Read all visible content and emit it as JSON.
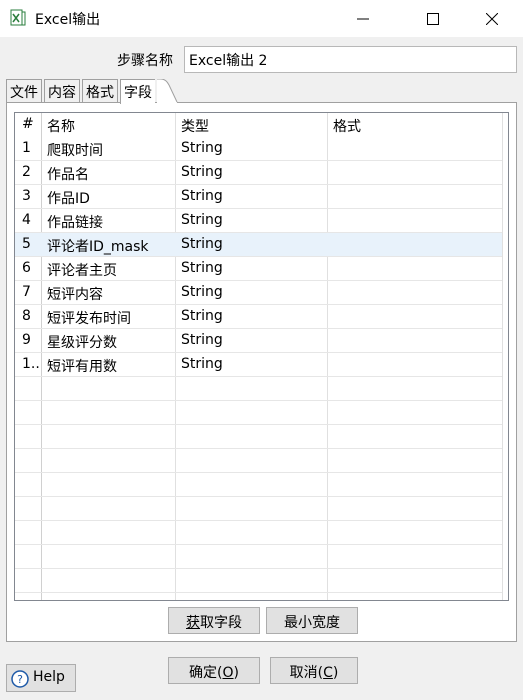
{
  "window": {
    "title": "Excel输出"
  },
  "step_name": {
    "label": "步骤名称",
    "value": "Excel输出 2"
  },
  "tabs": [
    {
      "label": "文件"
    },
    {
      "label": "内容"
    },
    {
      "label": "格式"
    },
    {
      "label": "字段"
    }
  ],
  "active_tab": "字段",
  "grid": {
    "columns": [
      "#",
      "名称",
      "类型",
      "格式"
    ],
    "rows": [
      {
        "num": "1",
        "name": "爬取时间",
        "type": "String",
        "format": ""
      },
      {
        "num": "2",
        "name": "作品名",
        "type": "String",
        "format": ""
      },
      {
        "num": "3",
        "name": "作品ID",
        "type": "String",
        "format": ""
      },
      {
        "num": "4",
        "name": "作品链接",
        "type": "String",
        "format": ""
      },
      {
        "num": "5",
        "name": "评论者ID_mask",
        "type": "String",
        "format": ""
      },
      {
        "num": "6",
        "name": "评论者主页",
        "type": "String",
        "format": ""
      },
      {
        "num": "7",
        "name": "短评内容",
        "type": "String",
        "format": ""
      },
      {
        "num": "8",
        "name": "短评发布时间",
        "type": "String",
        "format": ""
      },
      {
        "num": "9",
        "name": "星级评分数",
        "type": "String",
        "format": ""
      },
      {
        "num": "1..",
        "name": "短评有用数",
        "type": "String",
        "format": ""
      }
    ],
    "selected_row": 5
  },
  "buttons": {
    "get_fields": {
      "pre": "",
      "ul": "获",
      "post": "取字段"
    },
    "min_width": "最小宽度",
    "ok": {
      "pre": "确定(",
      "ul": "O",
      "post": ")"
    },
    "cancel": {
      "pre": "取消(",
      "ul": "C",
      "post": ")"
    },
    "help": "Help"
  },
  "colors": {
    "selected_row": "#e8f2fb",
    "window_bg": "#f0f0f0"
  }
}
